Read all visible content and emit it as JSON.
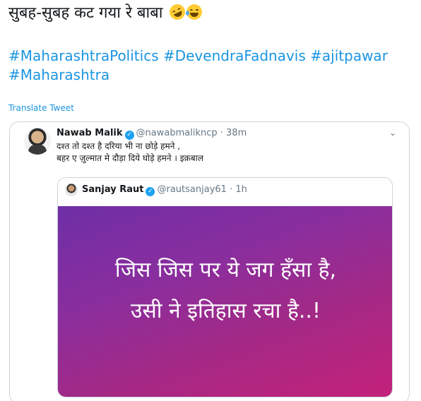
{
  "tweet": {
    "text": "सुबह-सुबह कट गया रे बाबा",
    "emojis": [
      "rolling-on-floor-laughing-icon",
      "face-with-tears-of-joy-icon"
    ],
    "hashtags": [
      "#MaharashtraPolitics",
      "#DevendraFadnavis",
      "#ajitpawar",
      "#Maharashtra"
    ],
    "translate_label": "Translate Tweet"
  },
  "quoted": {
    "name": "Nawab Malik",
    "handle": "@nawabmalikncp",
    "time": "38m",
    "line1": "दश्त तो दश्त है दरिया भी ना छोड़े हमने ,",
    "line2": "बहर ए ज़ुल्मात मे दौड़ा दिये घोड़े हमने । इक़बाल"
  },
  "nested": {
    "name": "Sanjay Raut",
    "handle": "@rautsanjay61",
    "time": "1h",
    "image_line1": "जिस जिस पर ये जग हँसा है,",
    "image_line2": "उसी ने इतिहास रचा है..!"
  },
  "colors": {
    "link": "#1b95e0",
    "verified": "#1da1f2",
    "border": "#ccd6dd",
    "media_start": "#6e2fa6",
    "media_end": "#c4217a"
  }
}
